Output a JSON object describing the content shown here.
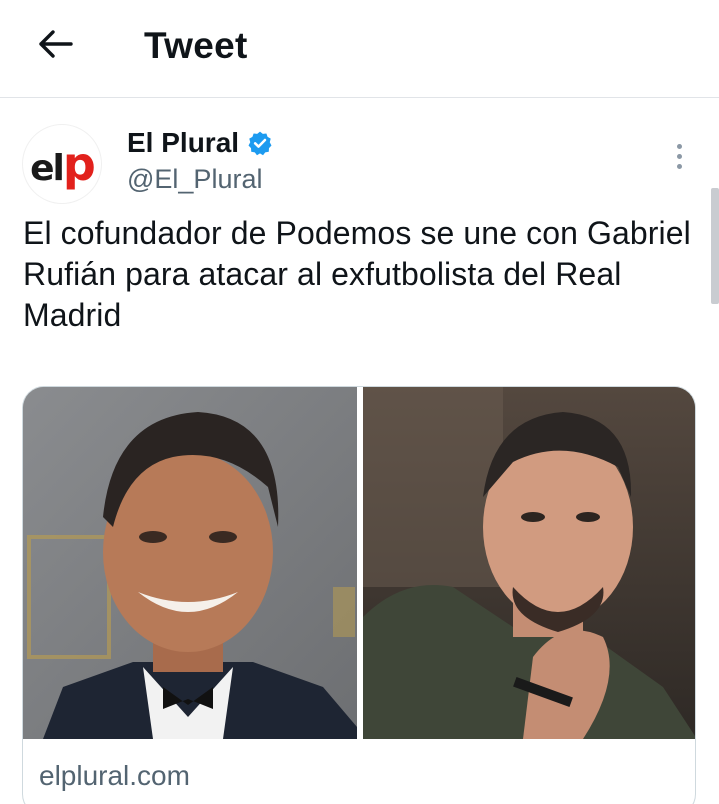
{
  "header": {
    "back_icon": "arrow-left-icon",
    "title": "Tweet"
  },
  "tweet": {
    "author": {
      "name": "El Plural",
      "handle": "@El_Plural",
      "avatar_text_el": "el",
      "avatar_text_p": "p",
      "verified": true,
      "verified_color": "#1d9bf0"
    },
    "text": "El cofundador de Podemos se une con Gabriel Rufián para atacar al exfutbolista del Real Madrid",
    "card": {
      "domain": "elplural.com",
      "image_left_subject": "man-in-tuxedo-photo",
      "image_right_subject": "man-in-green-hoodie-photo"
    }
  },
  "colors": {
    "text_primary": "#0f1419",
    "text_secondary": "#536471",
    "border": "#cfd9de",
    "brand_red": "#e2211c"
  }
}
